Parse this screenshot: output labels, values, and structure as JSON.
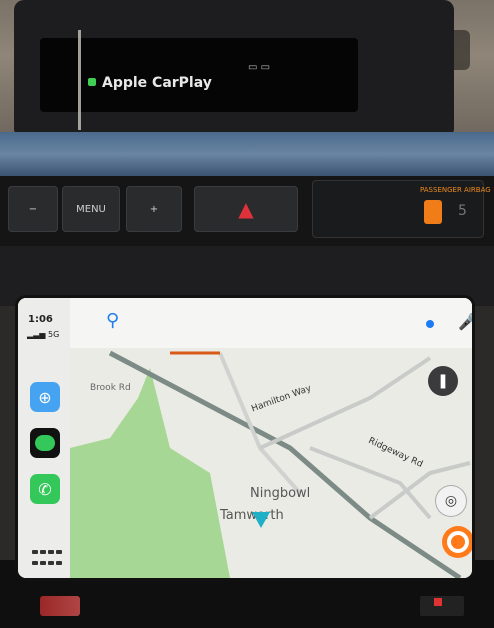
{
  "car": {
    "display_title": "Apple CarPlay",
    "menu_button": "MENU",
    "airbag_label": "PASSENGER AIRBAG",
    "airbag_count": "5"
  },
  "status": {
    "time": "1:06",
    "signal": "5G"
  },
  "map": {
    "places": [
      "Ningbowl",
      "Tamworth"
    ],
    "roads": [
      "Hamilton Way",
      "Ridgeway Rd",
      "Brook Rd"
    ]
  },
  "icons": {
    "search": "search-icon",
    "mic": "mic-icon",
    "maps_app": "maps-icon",
    "messages_app": "messages-icon",
    "phone_app": "phone-icon"
  },
  "colors": {
    "accent_blue": "#1e7cf2",
    "park_green": "#a6d794",
    "nav_cyan": "#1fb0c8",
    "orange": "#ff7a1a"
  }
}
